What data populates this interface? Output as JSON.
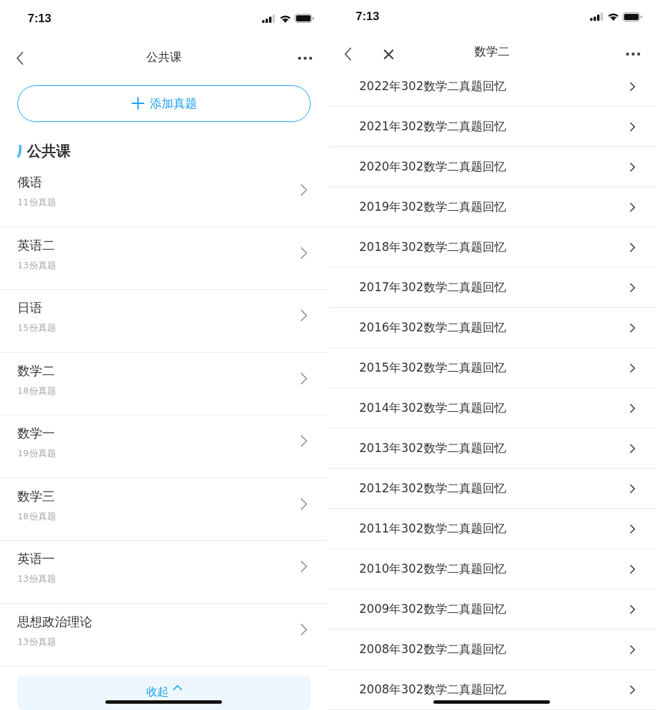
{
  "left_screen": {
    "status_bar": {
      "time": "7:13"
    },
    "nav_bar": {
      "title": "公共课"
    },
    "add_button": {
      "label": "添加真题"
    },
    "section": {
      "title": "公共课"
    },
    "subjects": [
      {
        "name": "俄语",
        "count": "11份真题"
      },
      {
        "name": "英语二",
        "count": "13份真题"
      },
      {
        "name": "日语",
        "count": "15份真题"
      },
      {
        "name": "数学二",
        "count": "18份真题"
      },
      {
        "name": "数学一",
        "count": "19份真题"
      },
      {
        "name": "数学三",
        "count": "18份真题"
      },
      {
        "name": "英语一",
        "count": "13份真题"
      },
      {
        "name": "思想政治理论",
        "count": "13份真题"
      }
    ],
    "collapse_button": {
      "label": "收起"
    }
  },
  "right_screen": {
    "status_bar": {
      "time": "7:13"
    },
    "nav_bar": {
      "title": "数学二"
    },
    "papers": [
      "2022年302数学二真题回忆",
      "2021年302数学二真题回忆",
      "2020年302数学二真题回忆",
      "2019年302数学二真题回忆",
      "2018年302数学二真题回忆",
      "2017年302数学二真题回忆",
      "2016年302数学二真题回忆",
      "2015年302数学二真题回忆",
      "2014年302数学二真题回忆",
      "2013年302数学二真题回忆",
      "2012年302数学二真题回忆",
      "2011年302数学二真题回忆",
      "2010年302数学二真题回忆",
      "2009年302数学二真题回忆",
      "2008年302数学二真题回忆",
      "2008年302数学二真题回忆"
    ]
  }
}
